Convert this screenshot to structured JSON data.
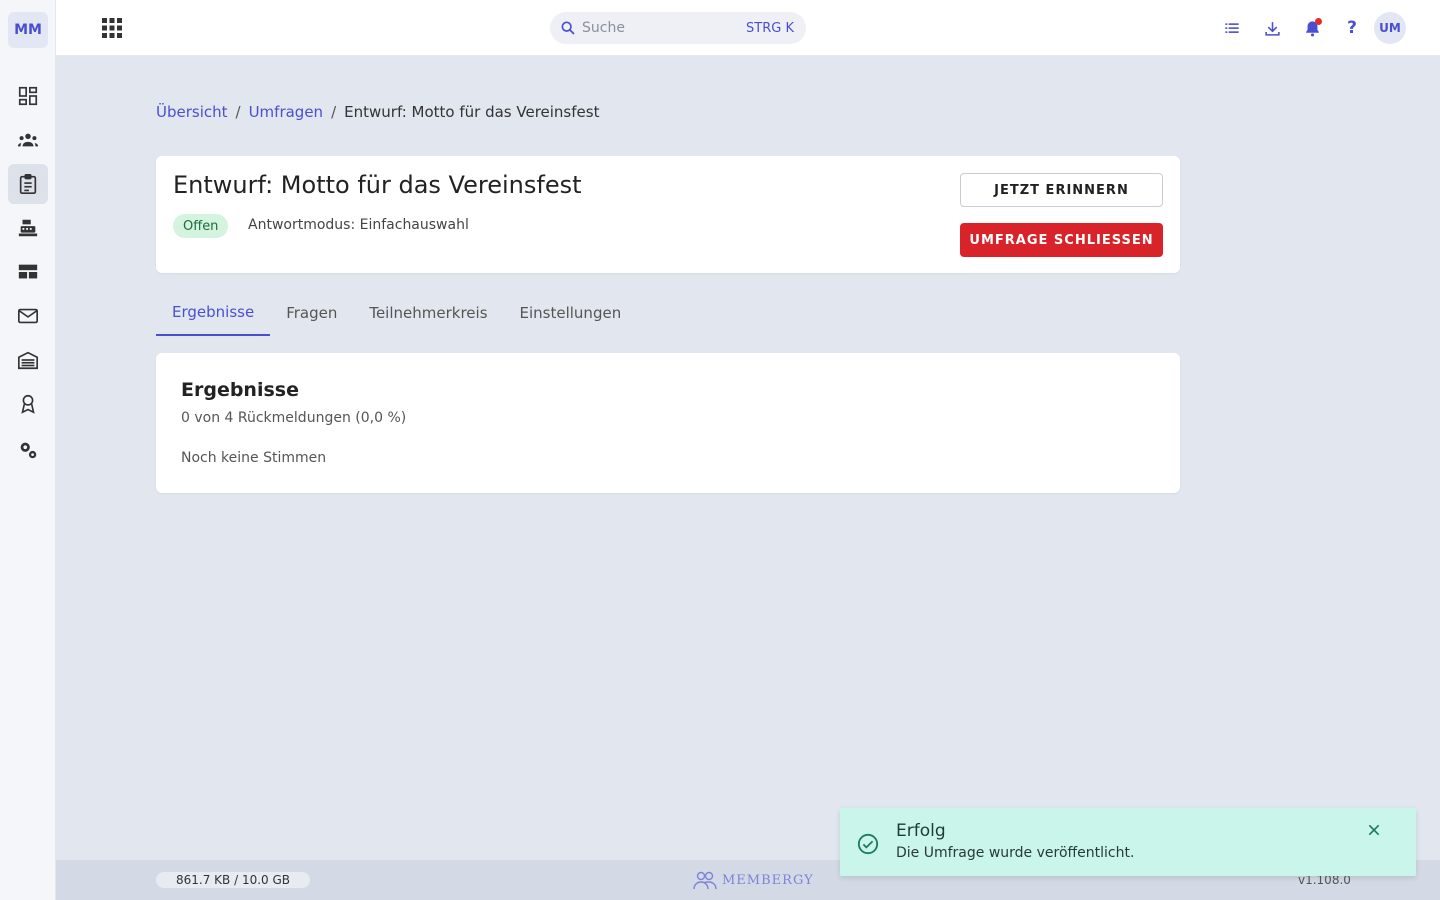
{
  "sidebar": {
    "logo": "MM",
    "items": [
      {
        "name": "dashboard",
        "icon": "dashboard-icon"
      },
      {
        "name": "members",
        "icon": "group-icon"
      },
      {
        "name": "surveys",
        "icon": "clipboard-icon",
        "active": true
      },
      {
        "name": "cashbox",
        "icon": "cash-register-icon"
      },
      {
        "name": "layout",
        "icon": "table-rows-icon"
      },
      {
        "name": "mail",
        "icon": "mail-icon"
      },
      {
        "name": "facilities",
        "icon": "warehouse-icon"
      },
      {
        "name": "awards",
        "icon": "award-icon"
      },
      {
        "name": "settings",
        "icon": "settings-icon"
      }
    ]
  },
  "topbar": {
    "search_placeholder": "Suche",
    "search_shortcut": "STRG K",
    "avatar": "UM"
  },
  "breadcrumb": {
    "items": [
      "Übersicht",
      "Umfragen"
    ],
    "current": "Entwurf: Motto für das Vereinsfest"
  },
  "header": {
    "title": "Entwurf: Motto für das Vereinsfest",
    "status": "Offen",
    "mode": "Antwortmodus: Einfachauswahl",
    "remind_label": "JETZT ERINNERN",
    "close_label": "UMFRAGE SCHLIESSEN"
  },
  "tabs": [
    {
      "label": "Ergebnisse",
      "active": true
    },
    {
      "label": "Fragen"
    },
    {
      "label": "Teilnehmerkreis"
    },
    {
      "label": "Einstellungen"
    }
  ],
  "results": {
    "title": "Ergebnisse",
    "count": "0 von 4 Rückmeldungen (0,0 %)",
    "empty": "Noch keine Stimmen"
  },
  "footer": {
    "storage": "861.7 KB / 10.0 GB",
    "brand": "MEMBERGY",
    "version": "v1.108.0"
  },
  "toast": {
    "title": "Erfolg",
    "message": "Die Umfrage wurde veröffentlicht."
  },
  "colors": {
    "accent": "#4a4fd1",
    "danger": "#d9232a",
    "success_bg": "#c9f5ea",
    "badge_bg": "#d4f4e0",
    "page_bg": "#e2e7ef"
  }
}
